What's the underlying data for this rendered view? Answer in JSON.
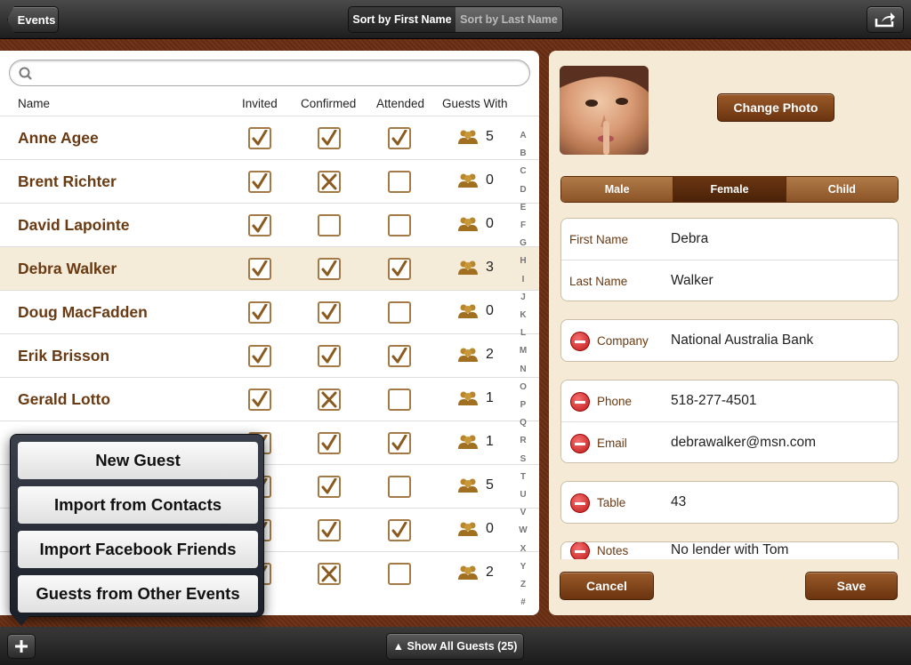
{
  "topbar": {
    "back_label": "Events",
    "sort_first": "Sort by First Name",
    "sort_last": "Sort by Last Name",
    "share_icon": "share-icon"
  },
  "search": {
    "placeholder": ""
  },
  "columns": {
    "name": "Name",
    "invited": "Invited",
    "confirmed": "Confirmed",
    "attended": "Attended",
    "guests_with": "Guests With"
  },
  "guests": [
    {
      "name": "Anne Agee",
      "invited": "check",
      "confirmed": "check",
      "attended": "check",
      "guests": "5"
    },
    {
      "name": "Brent Richter",
      "invited": "check",
      "confirmed": "x",
      "attended": "empty",
      "guests": "0"
    },
    {
      "name": "David Lapointe",
      "invited": "check",
      "confirmed": "empty",
      "attended": "empty",
      "guests": "0"
    },
    {
      "name": "Debra Walker",
      "invited": "check",
      "confirmed": "check",
      "attended": "check",
      "guests": "3",
      "selected": true
    },
    {
      "name": "Doug MacFadden",
      "invited": "check",
      "confirmed": "check",
      "attended": "empty",
      "guests": "0"
    },
    {
      "name": "Erik Brisson",
      "invited": "check",
      "confirmed": "check",
      "attended": "check",
      "guests": "2"
    },
    {
      "name": "Gerald Lotto",
      "invited": "check",
      "confirmed": "x",
      "attended": "empty",
      "guests": "1"
    },
    {
      "name": "",
      "invited": "check",
      "confirmed": "check",
      "attended": "check",
      "guests": "1"
    },
    {
      "name": "",
      "invited": "check",
      "confirmed": "check",
      "attended": "empty",
      "guests": "5"
    },
    {
      "name": "",
      "invited": "check",
      "confirmed": "check",
      "attended": "check",
      "guests": "0"
    },
    {
      "name": "",
      "invited": "check",
      "confirmed": "x",
      "attended": "empty",
      "guests": "2"
    }
  ],
  "index_letters": [
    "A",
    "B",
    "C",
    "D",
    "E",
    "F",
    "G",
    "H",
    "I",
    "J",
    "K",
    "L",
    "M",
    "N",
    "O",
    "P",
    "Q",
    "R",
    "S",
    "T",
    "U",
    "V",
    "W",
    "X",
    "Y",
    "Z",
    "#"
  ],
  "detail": {
    "change_photo": "Change Photo",
    "genders": [
      "Male",
      "Female",
      "Child"
    ],
    "selected_gender": "Female",
    "first_name_label": "First Name",
    "first_name": "Debra",
    "last_name_label": "Last Name",
    "last_name": "Walker",
    "company_label": "Company",
    "company": "National Australia Bank",
    "phone_label": "Phone",
    "phone": "518-277-4501",
    "email_label": "Email",
    "email": "debrawalker@msn.com",
    "table_label": "Table",
    "table": "43",
    "notes_label": "Notes",
    "notes": "No lender with Tom",
    "cancel": "Cancel",
    "save": "Save"
  },
  "popover": {
    "items": [
      "New Guest",
      "Import from Contacts",
      "Import Facebook Friends",
      "Guests from Other Events"
    ]
  },
  "bottombar": {
    "add_icon": "plus-icon",
    "show_all": "▲ Show All Guests (25)"
  }
}
